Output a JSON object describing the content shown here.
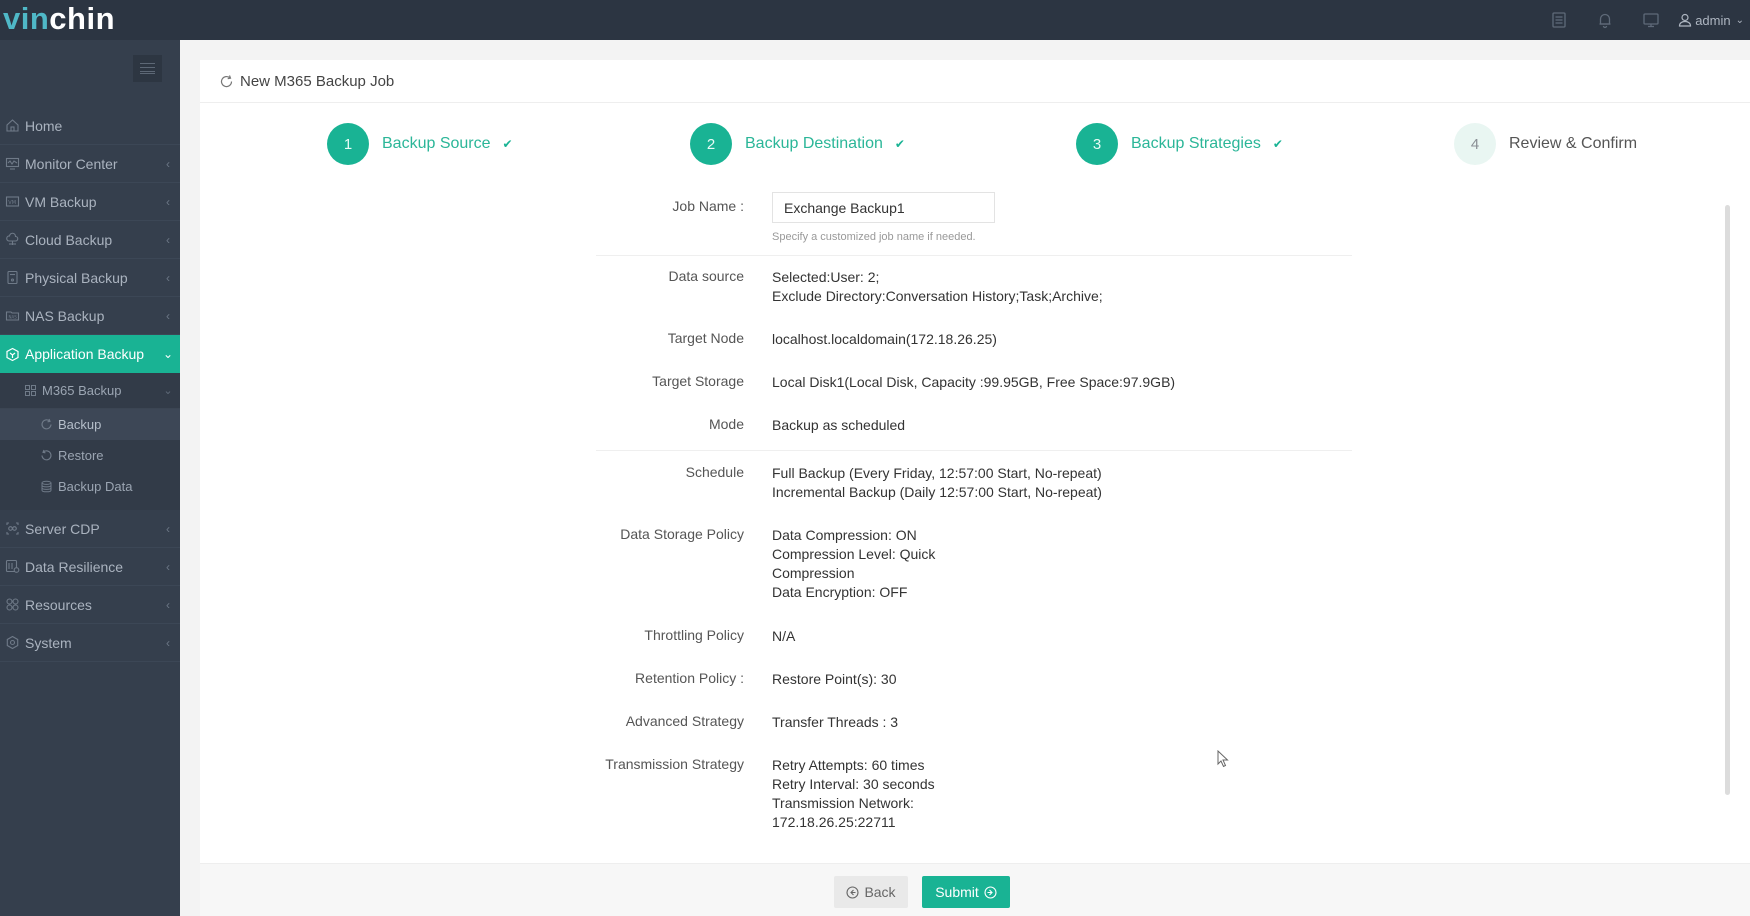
{
  "app": {
    "logo_part1": "vin",
    "logo_part2": "chin",
    "user": "admin"
  },
  "colors": {
    "accent": "#19b394",
    "topbar": "#2c3542",
    "sidebar": "#353f4d"
  },
  "topbar": {
    "icons": [
      "task-list-icon",
      "bell-icon",
      "monitor-icon",
      "user-icon"
    ]
  },
  "sidebar": {
    "items": [
      {
        "label": "Home",
        "icon": "home-icon"
      },
      {
        "label": "Monitor Center",
        "icon": "monitor-chart-icon"
      },
      {
        "label": "VM Backup",
        "icon": "vm-icon"
      },
      {
        "label": "Cloud Backup",
        "icon": "cloud-icon"
      },
      {
        "label": "Physical Backup",
        "icon": "server-icon"
      },
      {
        "label": "NAS Backup",
        "icon": "nas-icon"
      },
      {
        "label": "Application Backup",
        "icon": "app-icon",
        "active": true
      },
      {
        "label": "Server CDP",
        "icon": "cdp-icon"
      },
      {
        "label": "Data Resilience",
        "icon": "resilience-icon"
      },
      {
        "label": "Resources",
        "icon": "resources-icon"
      },
      {
        "label": "System",
        "icon": "gear-icon"
      }
    ],
    "submenu": {
      "group_label": "M365 Backup",
      "items": [
        {
          "label": "Backup",
          "selected": true
        },
        {
          "label": "Restore"
        },
        {
          "label": "Backup Data"
        }
      ]
    }
  },
  "page": {
    "title": "New M365 Backup Job"
  },
  "steps": [
    {
      "num": "1",
      "label": "Backup Source",
      "done": true
    },
    {
      "num": "2",
      "label": "Backup Destination",
      "done": true
    },
    {
      "num": "3",
      "label": "Backup Strategies",
      "done": true
    },
    {
      "num": "4",
      "label": "Review & Confirm",
      "done": false
    }
  ],
  "form": {
    "job_name_label": "Job Name :",
    "job_name_value": "Exchange Backup1",
    "job_name_hint": "Specify a customized job name if needed.",
    "fields": {
      "data_source": {
        "label": "Data source",
        "lines": [
          "Selected:User: 2;",
          "Exclude Directory:Conversation History;Task;Archive;"
        ]
      },
      "target_node": {
        "label": "Target Node",
        "lines": [
          "localhost.localdomain(172.18.26.25)"
        ]
      },
      "target_storage": {
        "label": "Target Storage",
        "lines": [
          "Local Disk1(Local Disk, Capacity :99.95GB, Free Space:97.9GB)"
        ]
      },
      "mode": {
        "label": "Mode",
        "lines": [
          "Backup as scheduled"
        ]
      },
      "schedule": {
        "label": "Schedule",
        "lines": [
          "Full Backup (Every Friday, 12:57:00 Start, No-repeat)",
          "Incremental Backup (Daily 12:57:00 Start, No-repeat)"
        ]
      },
      "data_storage_policy": {
        "label": "Data Storage Policy",
        "lines": [
          "Data Compression: ON",
          "Compression Level: Quick",
          "Compression",
          "Data Encryption: OFF"
        ]
      },
      "throttling_policy": {
        "label": "Throttling Policy",
        "lines": [
          "N/A"
        ]
      },
      "retention_policy": {
        "label": "Retention Policy :",
        "lines": [
          "Restore Point(s): 30"
        ]
      },
      "advanced_strategy": {
        "label": "Advanced Strategy",
        "lines": [
          "Transfer Threads : 3"
        ]
      },
      "transmission_strategy": {
        "label": "Transmission Strategy",
        "lines": [
          "Retry Attempts: 60 times",
          "Retry Interval: 30 seconds",
          "Transmission Network:",
          "172.18.26.25:22711"
        ]
      }
    }
  },
  "footer": {
    "back_label": "Back",
    "submit_label": "Submit"
  }
}
